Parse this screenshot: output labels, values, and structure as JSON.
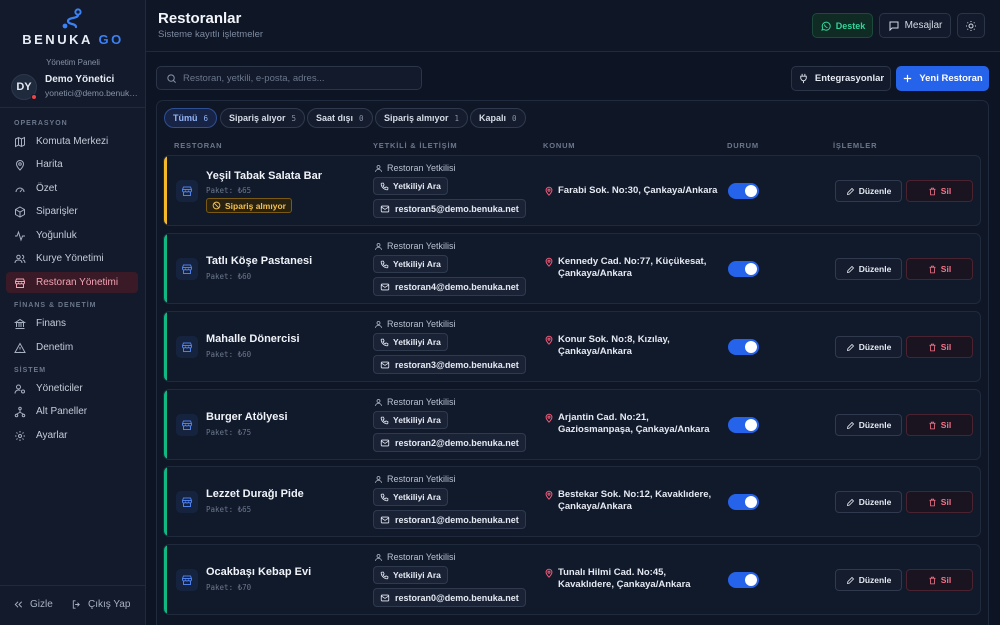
{
  "brand": {
    "name_part1": "BENUKA",
    "name_part2": "GO",
    "panel_label": "Yönetim Paneli"
  },
  "user": {
    "initials": "DY",
    "name": "Demo Yönetici",
    "email": "yonetici@demo.benuka.net"
  },
  "sidebar": {
    "sections": [
      {
        "title": "OPERASYON",
        "items": [
          {
            "label": "Komuta Merkezi",
            "icon": "map-icon"
          },
          {
            "label": "Harita",
            "icon": "map-pin-icon"
          },
          {
            "label": "Özet",
            "icon": "gauge-icon"
          },
          {
            "label": "Siparişler",
            "icon": "package-icon"
          },
          {
            "label": "Yoğunluk",
            "icon": "activity-icon"
          },
          {
            "label": "Kurye Yönetimi",
            "icon": "users-icon"
          },
          {
            "label": "Restoran Yönetimi",
            "icon": "store-icon",
            "active": true
          }
        ]
      },
      {
        "title": "FİNANS & DENETİM",
        "items": [
          {
            "label": "Finans",
            "icon": "bank-icon"
          },
          {
            "label": "Denetim",
            "icon": "alert-triangle-icon"
          }
        ]
      },
      {
        "title": "SİSTEM",
        "items": [
          {
            "label": "Yöneticiler",
            "icon": "user-cog-icon"
          },
          {
            "label": "Alt Paneller",
            "icon": "network-icon"
          },
          {
            "label": "Ayarlar",
            "icon": "gear-icon"
          }
        ]
      }
    ],
    "collapse_label": "Gizle",
    "logout_label": "Çıkış Yap"
  },
  "header": {
    "title": "Restoranlar",
    "subtitle": "Sisteme kayıtlı işletmeler",
    "support_label": "Destek",
    "messages_label": "Mesajlar"
  },
  "toolbar": {
    "search_placeholder": "Restoran, yetkili, e-posta, adres...",
    "integrations_label": "Entegrasyonlar",
    "new_label": "Yeni Restoran"
  },
  "filters": [
    {
      "label": "Tümü",
      "count": "6",
      "active": true
    },
    {
      "label": "Sipariş alıyor",
      "count": "5"
    },
    {
      "label": "Saat dışı",
      "count": "0"
    },
    {
      "label": "Sipariş almıyor",
      "count": "1"
    },
    {
      "label": "Kapalı",
      "count": "0"
    }
  ],
  "columns": {
    "restaurant": "RESTORAN",
    "contact": "YETKİLİ & İLETİŞİM",
    "location": "KONUM",
    "status": "DURUM",
    "actions": "İŞLEMLER"
  },
  "row_labels": {
    "contact_person": "Restoran Yetkilisi",
    "call": "Yetkiliyi Ara",
    "edit": "Düzenle",
    "delete": "Sil"
  },
  "colors": {
    "accent": "#2563eb",
    "open": "#10b981",
    "not_taking": "#f5b829",
    "danger": "#f47589"
  },
  "restaurants": [
    {
      "name": "Yeşil Tabak Salata Bar",
      "package": "Paket: ₺65",
      "badge": "Sipariş almıyor",
      "status": "not_taking",
      "email": "restoran5@demo.benuka.net",
      "address_line1": "Farabi Sok. No:30, Çankaya/Ankara",
      "address_line2": "",
      "active": true
    },
    {
      "name": "Tatlı Köşe Pastanesi",
      "package": "Paket: ₺60",
      "badge": "",
      "status": "open",
      "email": "restoran4@demo.benuka.net",
      "address_line1": "Kennedy Cad. No:77, Küçükesat,",
      "address_line2": "Çankaya/Ankara",
      "active": true
    },
    {
      "name": "Mahalle Dönercisi",
      "package": "Paket: ₺60",
      "badge": "",
      "status": "open",
      "email": "restoran3@demo.benuka.net",
      "address_line1": "Konur Sok. No:8, Kızılay,",
      "address_line2": "Çankaya/Ankara",
      "active": true
    },
    {
      "name": "Burger Atölyesi",
      "package": "Paket: ₺75",
      "badge": "",
      "status": "open",
      "email": "restoran2@demo.benuka.net",
      "address_line1": "Arjantin Cad. No:21,",
      "address_line2": "Gaziosmanpaşa, Çankaya/Ankara",
      "active": true
    },
    {
      "name": "Lezzet Durağı Pide",
      "package": "Paket: ₺65",
      "badge": "",
      "status": "open",
      "email": "restoran1@demo.benuka.net",
      "address_line1": "Bestekar Sok. No:12, Kavaklıdere,",
      "address_line2": "Çankaya/Ankara",
      "active": true
    },
    {
      "name": "Ocakbaşı Kebap Evi",
      "package": "Paket: ₺70",
      "badge": "",
      "status": "open",
      "email": "restoran0@demo.benuka.net",
      "address_line1": "Tunalı Hilmi Cad. No:45,",
      "address_line2": "Kavaklıdere, Çankaya/Ankara",
      "active": true
    }
  ]
}
